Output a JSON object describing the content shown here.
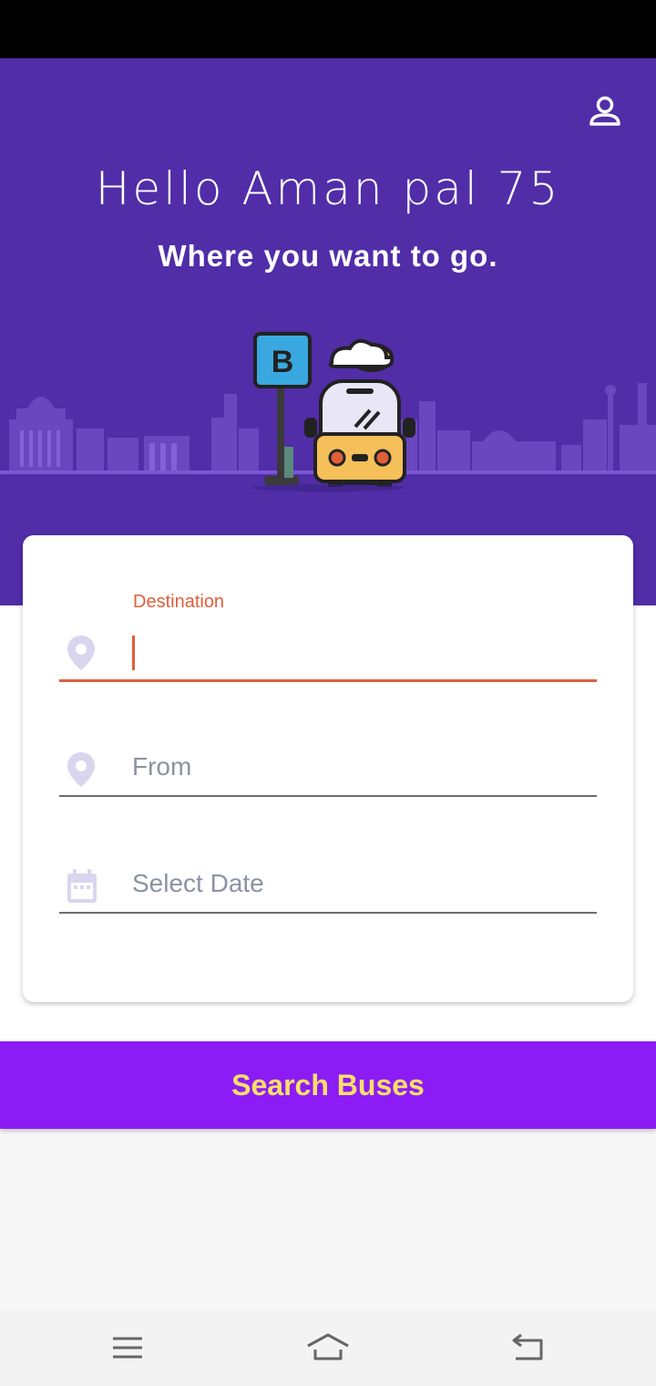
{
  "header": {
    "greeting": "Hello Aman pal 75",
    "subtitle": "Where you want to go.",
    "profile_icon": "person-icon",
    "stop_sign_letter": "B"
  },
  "form": {
    "destination": {
      "label": "Destination",
      "value": "",
      "icon": "location-pin-icon"
    },
    "from": {
      "placeholder": "From",
      "value": "",
      "icon": "location-pin-icon"
    },
    "date": {
      "placeholder": "Select Date",
      "value": "",
      "icon": "calendar-icon"
    }
  },
  "search_button": {
    "label": "Search Buses"
  },
  "nav": {
    "menu_icon": "menu-icon",
    "home_icon": "home-icon",
    "back_icon": "back-icon"
  },
  "colors": {
    "hero_bg": "#512da8",
    "accent": "#e0603a",
    "button_bg": "#8c1cf6",
    "button_text": "#ffe066"
  }
}
